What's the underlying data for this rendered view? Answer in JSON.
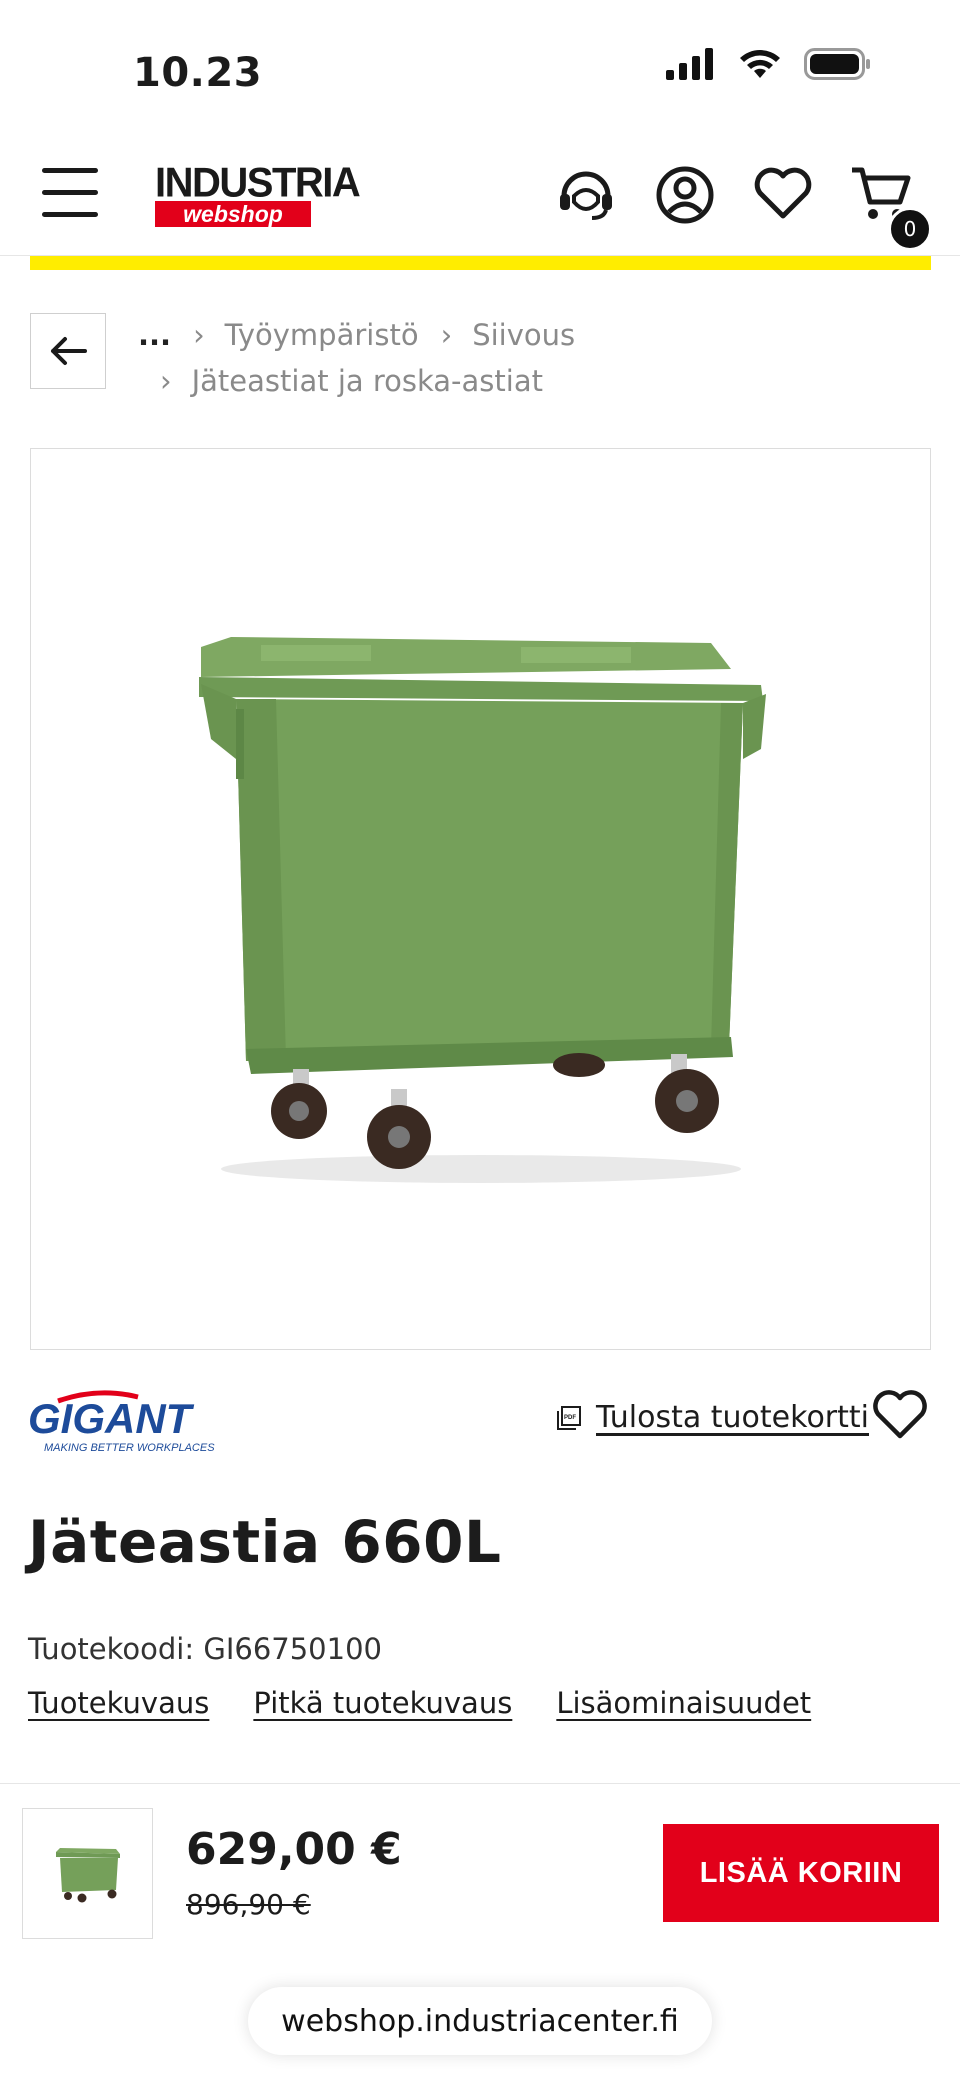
{
  "status_bar": {
    "time": "10.23"
  },
  "header": {
    "logo_top": "INDUSTRIA",
    "logo_bottom": "webshop",
    "cart_count": "0",
    "accent_color": "#e2001a",
    "banner_color": "#ffed00"
  },
  "breadcrumb": {
    "ellipsis": "...",
    "items": [
      "Työympäristö",
      "Siivous",
      "Jäteastiat ja roska-astiat"
    ]
  },
  "brand": {
    "name": "GIGANT",
    "tagline": "MAKING BETTER WORKPLACES"
  },
  "actions": {
    "print_label": "Tulosta tuotekortti"
  },
  "product": {
    "title": "Jäteastia 660L",
    "sku": "Tuotekoodi: GI66750100",
    "tabs": [
      "Tuotekuvaus",
      "Pitkä tuotekuvaus",
      "Lisäominaisuudet"
    ]
  },
  "purchase": {
    "price": "629,00 €",
    "old_price": "896,90 €",
    "add_to_cart": "LISÄÄ KORIIN"
  },
  "browser": {
    "url": "webshop.industriacenter.fi"
  }
}
